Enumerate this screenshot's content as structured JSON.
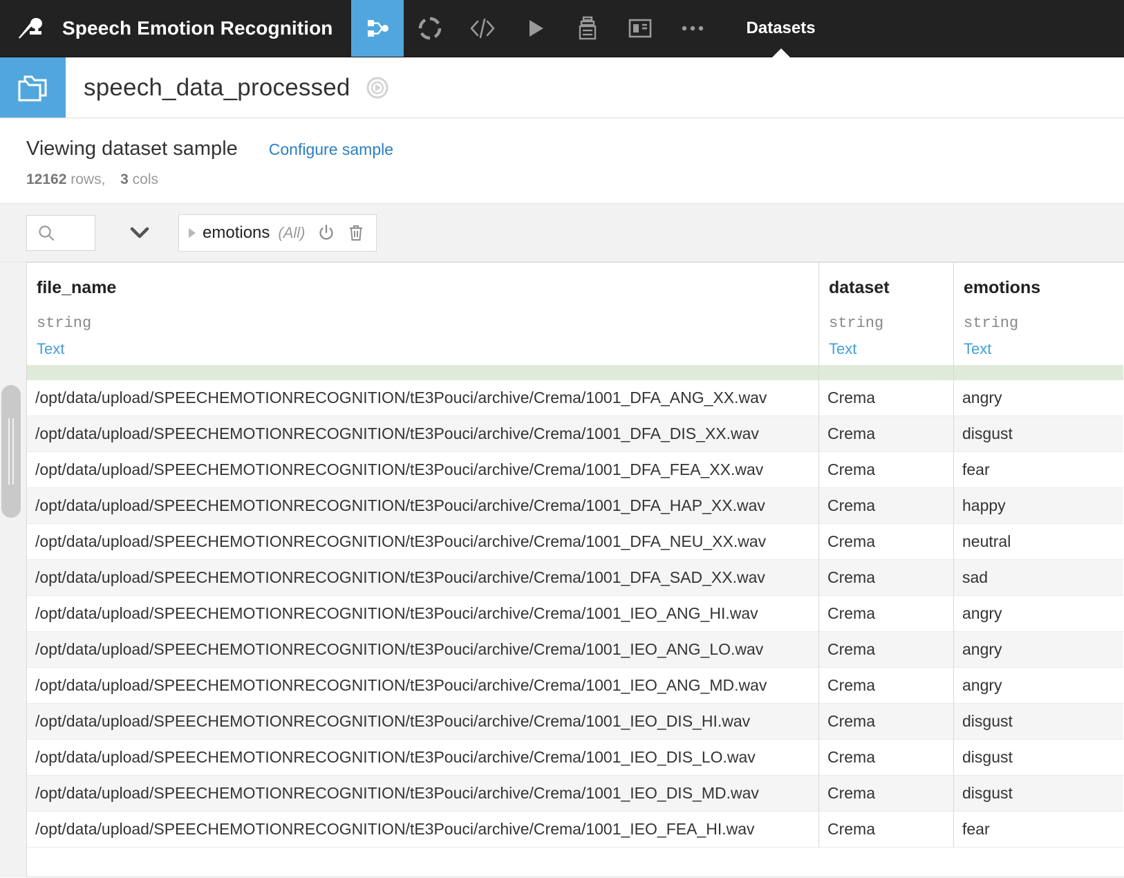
{
  "navbar": {
    "logo_icon": "dataiku-bird-logo",
    "project_name": "Speech Emotion Recognition",
    "icons": [
      {
        "name": "flow-icon",
        "label": "Flow"
      },
      {
        "name": "lab-icon",
        "label": "Lab"
      },
      {
        "name": "code-icon",
        "label": "Code"
      },
      {
        "name": "jobs-icon",
        "label": "Jobs"
      },
      {
        "name": "automation-icon",
        "label": "Automation"
      },
      {
        "name": "dashboards-icon",
        "label": "Dashboards"
      },
      {
        "name": "more-icon",
        "label": "More"
      }
    ],
    "active_tab": "Datasets"
  },
  "titlebar": {
    "folder_icon": "managed-folder-icon",
    "dataset_name": "speech_data_processed",
    "compass_icon": "navigator-icon"
  },
  "sample": {
    "title": "Viewing dataset sample",
    "configure_link": "Configure sample",
    "rows_count": "12162",
    "rows_label": "rows,",
    "cols_count": "3",
    "cols_label": "cols"
  },
  "filterbar": {
    "search_icon": "search-icon",
    "search_value": "",
    "search_placeholder": "",
    "chevron_icon": "chevron-down-icon",
    "filter": {
      "expand_icon": "triangle-right-icon",
      "label": "emotions",
      "scope": "(All)",
      "toggle_icon": "power-toggle-icon",
      "delete_icon": "trash-icon"
    }
  },
  "table": {
    "columns": [
      {
        "name": "file_name",
        "type": "string",
        "meaning": "Text"
      },
      {
        "name": "dataset",
        "type": "string",
        "meaning": "Text"
      },
      {
        "name": "emotions",
        "type": "string",
        "meaning": "Text"
      }
    ],
    "rows": [
      {
        "file_name": "/opt/data/upload/SPEECHEMOTIONRECOGNITION/tE3Pouci/archive/Crema/1001_DFA_ANG_XX.wav",
        "dataset": "Crema",
        "emotions": "angry"
      },
      {
        "file_name": "/opt/data/upload/SPEECHEMOTIONRECOGNITION/tE3Pouci/archive/Crema/1001_DFA_DIS_XX.wav",
        "dataset": "Crema",
        "emotions": "disgust"
      },
      {
        "file_name": "/opt/data/upload/SPEECHEMOTIONRECOGNITION/tE3Pouci/archive/Crema/1001_DFA_FEA_XX.wav",
        "dataset": "Crema",
        "emotions": "fear"
      },
      {
        "file_name": "/opt/data/upload/SPEECHEMOTIONRECOGNITION/tE3Pouci/archive/Crema/1001_DFA_HAP_XX.wav",
        "dataset": "Crema",
        "emotions": "happy"
      },
      {
        "file_name": "/opt/data/upload/SPEECHEMOTIONRECOGNITION/tE3Pouci/archive/Crema/1001_DFA_NEU_XX.wav",
        "dataset": "Crema",
        "emotions": "neutral"
      },
      {
        "file_name": "/opt/data/upload/SPEECHEMOTIONRECOGNITION/tE3Pouci/archive/Crema/1001_DFA_SAD_XX.wav",
        "dataset": "Crema",
        "emotions": "sad"
      },
      {
        "file_name": "/opt/data/upload/SPEECHEMOTIONRECOGNITION/tE3Pouci/archive/Crema/1001_IEO_ANG_HI.wav",
        "dataset": "Crema",
        "emotions": "angry"
      },
      {
        "file_name": "/opt/data/upload/SPEECHEMOTIONRECOGNITION/tE3Pouci/archive/Crema/1001_IEO_ANG_LO.wav",
        "dataset": "Crema",
        "emotions": "angry"
      },
      {
        "file_name": "/opt/data/upload/SPEECHEMOTIONRECOGNITION/tE3Pouci/archive/Crema/1001_IEO_ANG_MD.wav",
        "dataset": "Crema",
        "emotions": "angry"
      },
      {
        "file_name": "/opt/data/upload/SPEECHEMOTIONRECOGNITION/tE3Pouci/archive/Crema/1001_IEO_DIS_HI.wav",
        "dataset": "Crema",
        "emotions": "disgust"
      },
      {
        "file_name": "/opt/data/upload/SPEECHEMOTIONRECOGNITION/tE3Pouci/archive/Crema/1001_IEO_DIS_LO.wav",
        "dataset": "Crema",
        "emotions": "disgust"
      },
      {
        "file_name": "/opt/data/upload/SPEECHEMOTIONRECOGNITION/tE3Pouci/archive/Crema/1001_IEO_DIS_MD.wav",
        "dataset": "Crema",
        "emotions": "disgust"
      },
      {
        "file_name": "/opt/data/upload/SPEECHEMOTIONRECOGNITION/tE3Pouci/archive/Crema/1001_IEO_FEA_HI.wav",
        "dataset": "Crema",
        "emotions": "fear"
      }
    ]
  },
  "colors": {
    "accent_blue": "#51a7dd",
    "link_blue": "#2a7fc0",
    "navbar_dark": "#222222",
    "sample_strip_green": "#dfebd8"
  }
}
